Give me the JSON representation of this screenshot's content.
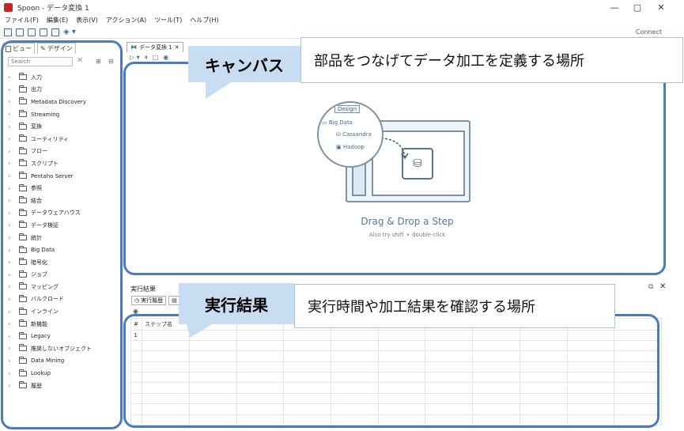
{
  "window": {
    "title": "Spoon - データ変換 1",
    "controls": {
      "minimize": "—",
      "maximize": "▢",
      "close": "✕"
    }
  },
  "menu": [
    "ファイル(F)",
    "編集(E)",
    "表示(V)",
    "アクション(A)",
    "ツール(T)",
    "ヘルプ(H)"
  ],
  "toolbar": {
    "connect_label": "Connect"
  },
  "left_panel": {
    "tabs": [
      "ビュー",
      "デザイン"
    ],
    "search_placeholder": "Search",
    "tree_items": [
      "入力",
      "出力",
      "Metadata Discovery",
      "Streaming",
      "変換",
      "ユーティリティ",
      "フロー",
      "スクリプト",
      "Pentaho Server",
      "参照",
      "結合",
      "データウェアハウス",
      "データ検証",
      "統計",
      "Big Data",
      "暗号化",
      "ジョブ",
      "マッピング",
      "バルクロード",
      "インライン",
      "新機能",
      "Legacy",
      "推奨しないオブジェクト",
      "Data Mining",
      "Lookup",
      "履歴"
    ]
  },
  "canvas": {
    "tab_label": "データ変換 1",
    "illustration": {
      "design_tab": "Design",
      "big_data": "Big Data",
      "cassandra": "Cassandra",
      "hadoop": "Hadoop"
    },
    "drag_drop_title": "Drag & Drop a Step",
    "drag_drop_subtitle": "Also try shift + double-click"
  },
  "results": {
    "title": "実行結果",
    "tabs": [
      "実行履歴"
    ],
    "grid_columns": [
      "#",
      "ステップ名"
    ],
    "grid_rows": [
      "1"
    ]
  },
  "callouts": {
    "canvas_label": "キャンバス",
    "canvas_desc": "部品をつなげてデータ加工を定義する場所",
    "results_label": "実行結果",
    "results_desc": "実行時間や加工結果を確認する場所"
  },
  "colors": {
    "outline": "#4b7bbd",
    "callout_label_bg": "#c8ddf1",
    "app_icon": "#c0282d",
    "illustration_stroke": "#7b93aa"
  }
}
